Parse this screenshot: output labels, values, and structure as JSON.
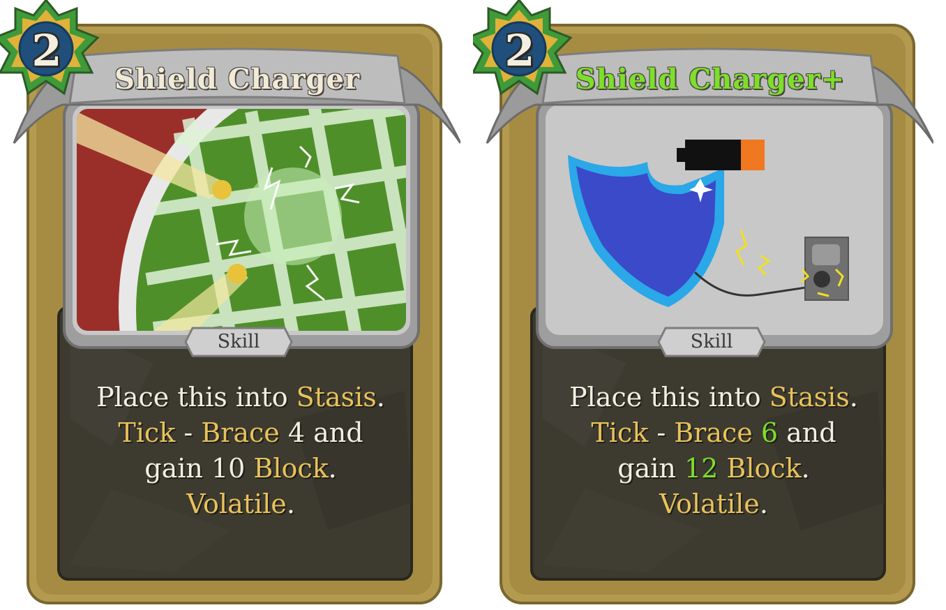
{
  "cards": [
    {
      "cost": "2",
      "name": "Shield Charger",
      "type": "Skill",
      "description": {
        "line1": {
          "t1": "Place this into ",
          "kw1": "Stasis",
          "t2": "."
        },
        "line2": {
          "kw1": "Tick",
          "t1": " - ",
          "kw2": "Brace",
          "num": " 4",
          "t2": " and"
        },
        "line3": {
          "t1": "gain ",
          "num": "10",
          "t2": " ",
          "kw1": "Block",
          "t3": "."
        },
        "line4": {
          "kw1": "Volatile",
          "t1": "."
        }
      }
    },
    {
      "cost": "2",
      "name": "Shield Charger+",
      "type": "Skill",
      "description": {
        "line1": {
          "t1": "Place this into ",
          "kw1": "Stasis",
          "t2": "."
        },
        "line2": {
          "kw1": "Tick",
          "t1": " - ",
          "kw2": "Brace",
          "num": " 6",
          "t2": " and"
        },
        "line3": {
          "t1": "gain ",
          "num": "12",
          "t2": " ",
          "kw1": "Block",
          "t3": "."
        },
        "line4": {
          "kw1": "Volatile",
          "t1": "."
        }
      }
    }
  ],
  "colors": {
    "keyword": "#e8c25a",
    "upgraded": "#7ddf2a",
    "frame_gold": "#b39a4e",
    "body_dark": "#3d3a30",
    "banner_gray": "#b9b9b9",
    "cost_orb_blue": "#1f4f7a",
    "cost_star_green": "#3f9a3a"
  },
  "icons": [
    "energy-cost-star-icon",
    "shield-icon",
    "battery-icon",
    "power-outlet-icon",
    "lightning-icon"
  ]
}
